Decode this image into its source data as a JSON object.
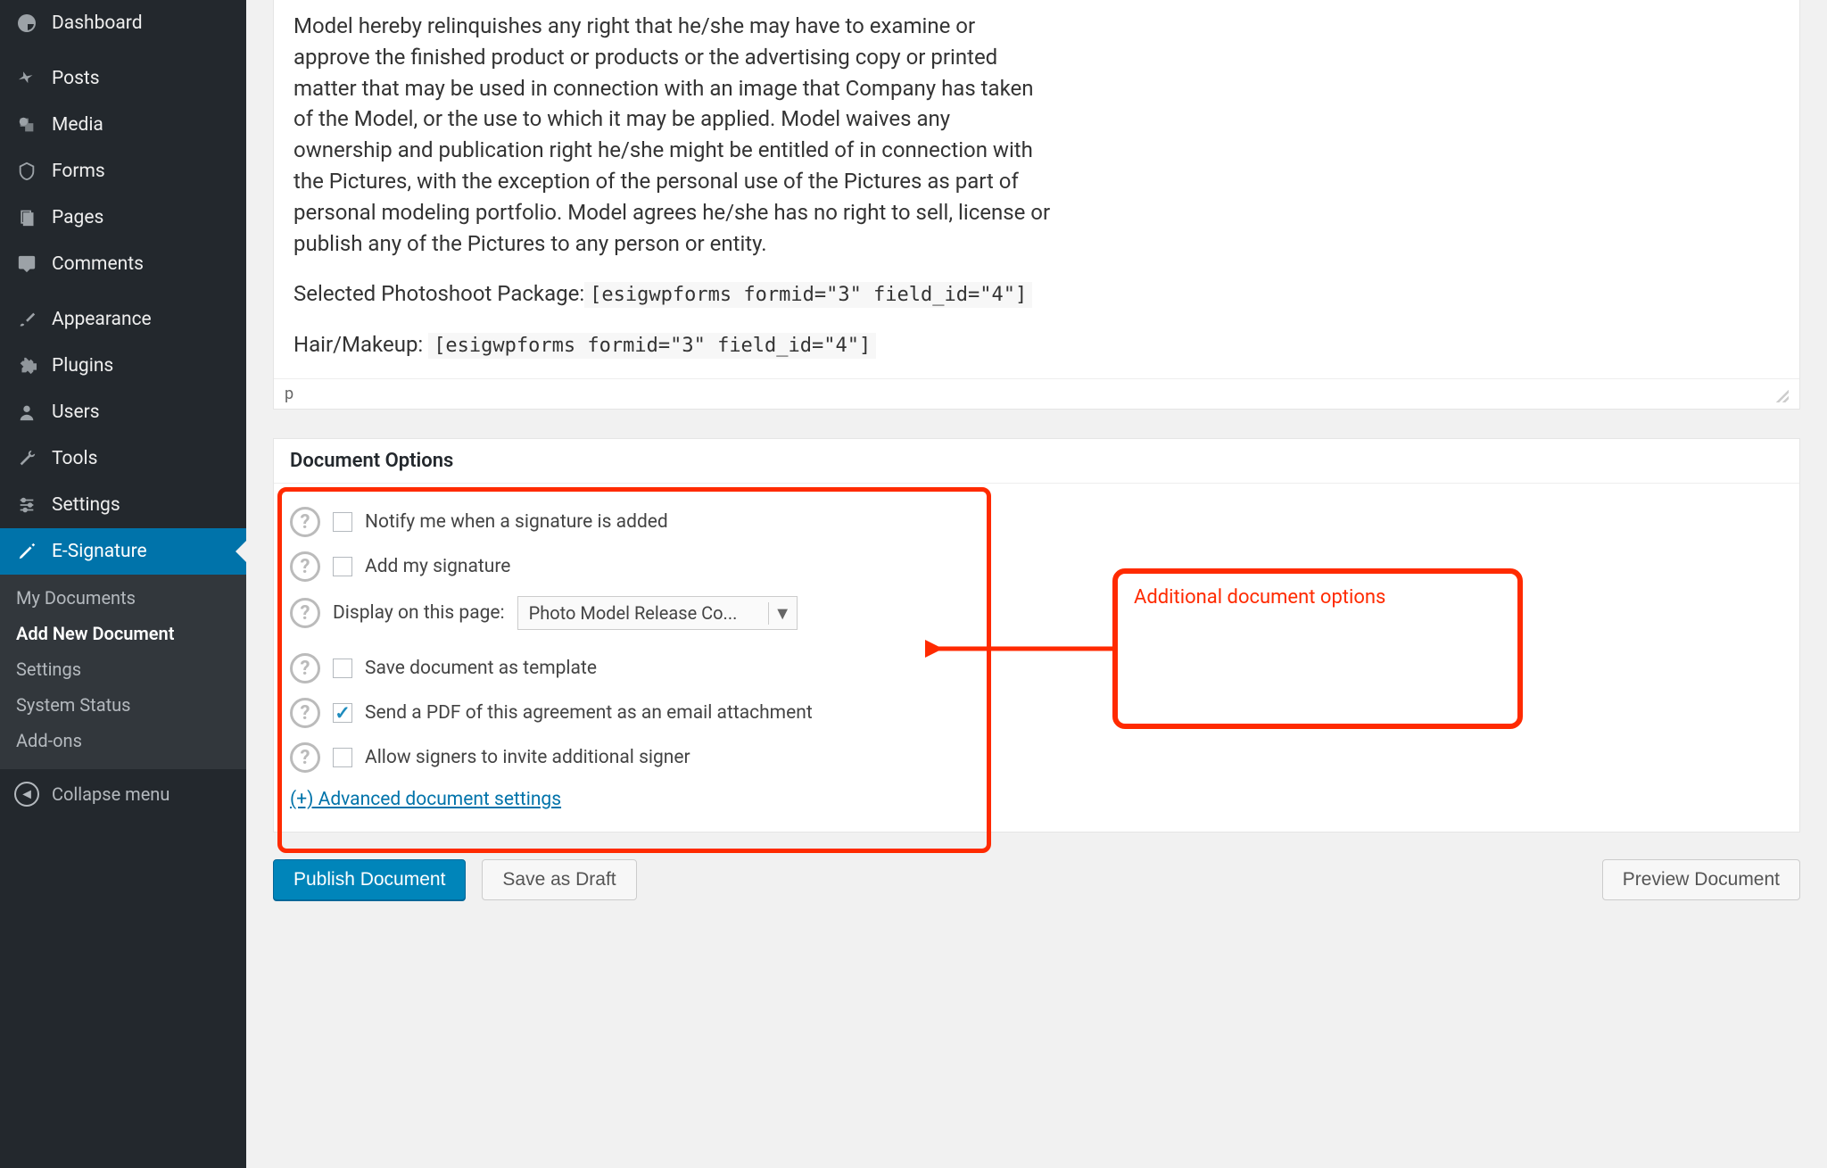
{
  "sidebar": {
    "dashboard": "Dashboard",
    "posts": "Posts",
    "media": "Media",
    "forms": "Forms",
    "pages": "Pages",
    "comments": "Comments",
    "appearance": "Appearance",
    "plugins": "Plugins",
    "users": "Users",
    "tools": "Tools",
    "settings": "Settings",
    "esignature": "E-Signature",
    "sub": {
      "my_documents": "My Documents",
      "add_new": "Add New Document",
      "settings": "Settings",
      "system_status": "System Status",
      "addons": "Add-ons"
    },
    "collapse": "Collapse menu"
  },
  "editor": {
    "body": "Model hereby relinquishes any right that he/she may have to examine or approve the finished product or products or the advertising copy or printed matter that may be used in connection with an image that Company has taken of the Model, or the use to which it may be applied. Model waives any ownership and publication right he/she might be entitled of in connection with the Pictures, with the exception of the personal use of the Pictures as part of personal modeling portfolio. Model agrees he/she has no right to sell, license or publish any of the Pictures to any person or entity.",
    "package_label": "Selected Photoshoot Package:",
    "package_code": "[esigwpforms formid=\"3\" field_id=\"4\"]",
    "hm_label": "Hair/Makeup: ",
    "hm_code": "[esigwpforms formid=\"3\" field_id=\"4\"]",
    "path": "p"
  },
  "doc_options": {
    "title": "Document Options",
    "notify": "Notify me when a signature is added",
    "add_sig": "Add my signature",
    "display_label": "Display on this page:",
    "display_value": "Photo Model Release Co...",
    "save_template": "Save document as template",
    "send_pdf": "Send a PDF of this agreement as an email attachment",
    "allow_invite": "Allow signers to invite additional signer",
    "advanced": "(+) Advanced document settings"
  },
  "annotation": {
    "callout": "Additional document options"
  },
  "buttons": {
    "publish": "Publish Document",
    "draft": "Save as Draft",
    "preview": "Preview Document"
  }
}
